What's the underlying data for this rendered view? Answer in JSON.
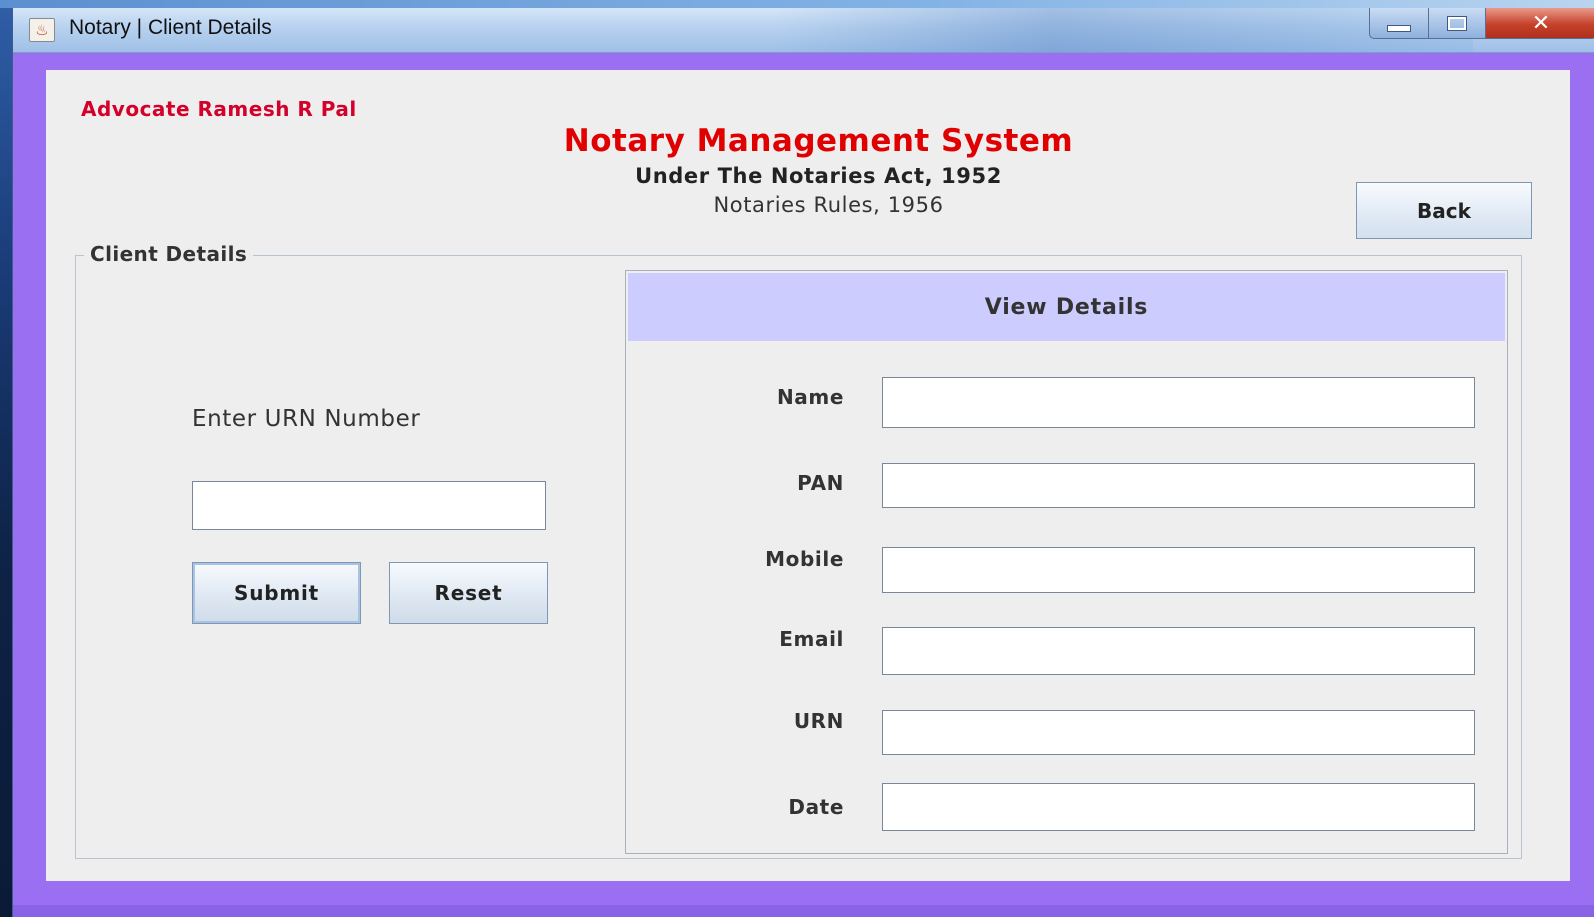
{
  "window": {
    "title": "Notary | Client Details",
    "controls": {
      "minimize": "minimize",
      "maximize": "maximize",
      "close": "✕"
    }
  },
  "header": {
    "advocate": "Advocate Ramesh R Pal",
    "system_title": "Notary Management System",
    "subtitle_act": "Under The Notaries Act, 1952",
    "subtitle_rules": "Notaries Rules, 1956",
    "back_label": "Back"
  },
  "client_details": {
    "legend": "Client Details",
    "urn_prompt": "Enter URN Number",
    "urn_value": "",
    "submit_label": "Submit",
    "reset_label": "Reset"
  },
  "view_details": {
    "heading": "View Details",
    "fields": [
      {
        "label": "Name",
        "value": ""
      },
      {
        "label": "PAN",
        "value": ""
      },
      {
        "label": "Mobile",
        "value": ""
      },
      {
        "label": "Email",
        "value": ""
      },
      {
        "label": "URN",
        "value": ""
      },
      {
        "label": "Date",
        "value": ""
      }
    ]
  },
  "colors": {
    "frame": "#9b6ff2",
    "title_red": "#e00000",
    "advocate_red": "#d4002a",
    "panel_header": "#ccccff",
    "content_bg": "#eeeeee"
  }
}
